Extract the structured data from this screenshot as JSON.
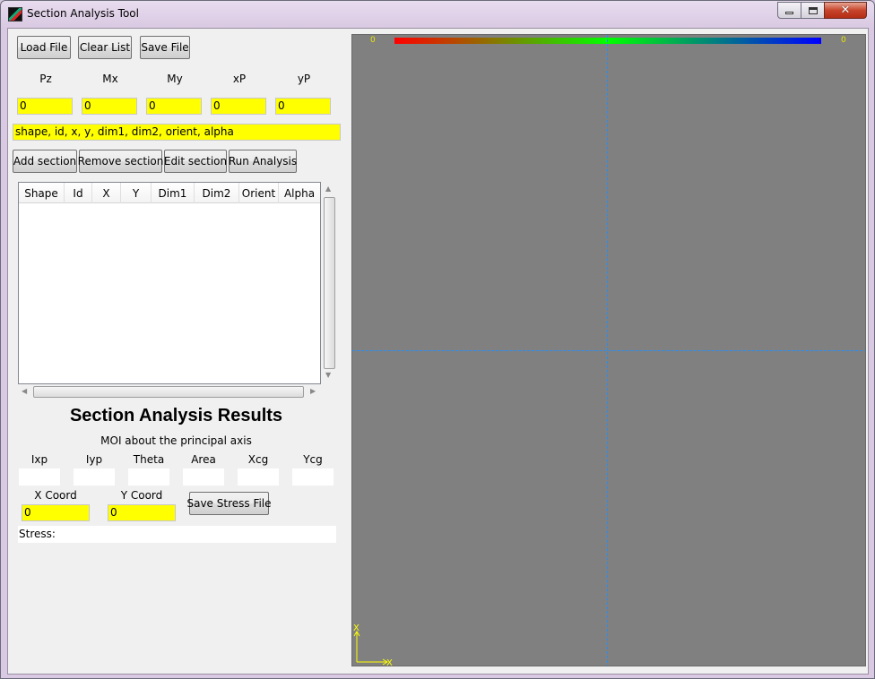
{
  "window": {
    "title": "Section Analysis Tool"
  },
  "toolbar": {
    "load": "Load File",
    "clear": "Clear List",
    "save": "Save File"
  },
  "loads": {
    "labels": [
      "Pz",
      "Mx",
      "My",
      "xP",
      "yP"
    ],
    "values": [
      "0",
      "0",
      "0",
      "0",
      "0"
    ]
  },
  "section_input": {
    "value": "shape, id, x, y, dim1, dim2, orient, alpha"
  },
  "section_buttons": {
    "add": "Add section",
    "remove": "Remove section",
    "edit": "Edit section",
    "run": "Run Analysis"
  },
  "list": {
    "columns": [
      "Shape",
      "Id",
      "X",
      "Y",
      "Dim1",
      "Dim2",
      "Orient",
      "Alpha"
    ]
  },
  "results": {
    "title": "Section Analysis Results",
    "subtitle": "MOI about the principal axis",
    "labels": [
      "Ixp",
      "Iyp",
      "Theta",
      "Area",
      "Xcg",
      "Ycg"
    ],
    "values": [
      "",
      "",
      "",
      "",
      "",
      ""
    ],
    "x_coord_label": "X Coord",
    "y_coord_label": "Y Coord",
    "x_coord": "0",
    "y_coord": "0",
    "save_stress": "Save Stress File",
    "stress": "Stress:"
  },
  "canvas": {
    "colorbar_min": "0",
    "colorbar_max": "0",
    "axis_x": "X",
    "axis_y": "X",
    "axis_color": "#ffff00",
    "grid_color": "#1e90ff",
    "background": "#808080"
  }
}
